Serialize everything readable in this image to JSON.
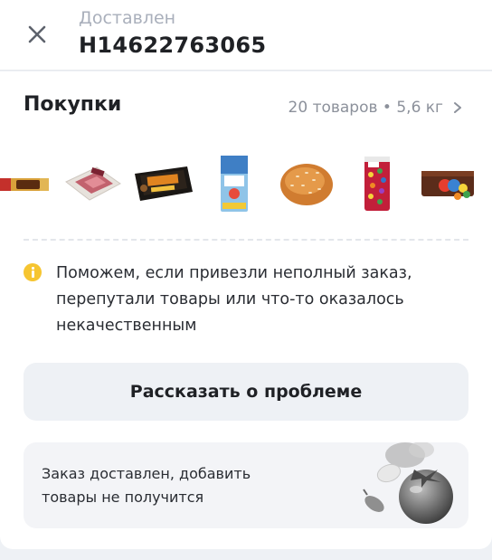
{
  "header": {
    "status": "Доставлен",
    "order_number": "Н14622763065"
  },
  "purchases": {
    "title": "Покупки",
    "meta": "20 товаров • 5,6 кг"
  },
  "products": [
    {
      "name": "Кубик батончик"
    },
    {
      "name": "Ветчина в упаковке"
    },
    {
      "name": "Закуска Жанна"
    },
    {
      "name": "Пачка продукта"
    },
    {
      "name": "Булочка с кунжутом"
    },
    {
      "name": "Драже в пакете"
    },
    {
      "name": "M&M's"
    }
  ],
  "info": {
    "text": "Поможем, если привезли неполный заказ, перепутали товары или что-то оказалось некачественным"
  },
  "report_button": {
    "label": "Рассказать о проблеме"
  },
  "notice": {
    "text": "Заказ доставлен, добавить товары не получится"
  },
  "colors": {
    "accent_yellow": "#f6c531",
    "muted_text": "#a9afbb",
    "button_bg": "#eef1f5"
  }
}
